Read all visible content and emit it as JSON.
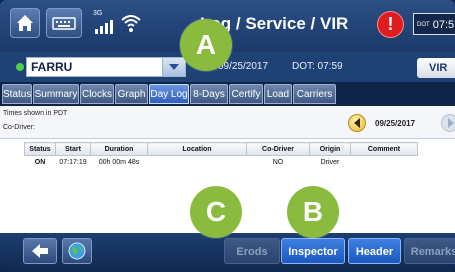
{
  "header": {
    "title": "Log / Service / VIR",
    "alert_symbol": "!",
    "dot_label": "DOT",
    "dot_time": "07:5",
    "network_label": "3G"
  },
  "driver": {
    "name": "FARRU",
    "date": "09/25/2017",
    "dot_time": "DOT: 07:59",
    "vir_label": "VIR"
  },
  "tabs": [
    {
      "label": "Status"
    },
    {
      "label": "Summary"
    },
    {
      "label": "Clocks"
    },
    {
      "label": "Graph"
    },
    {
      "label": "Day Log",
      "active": true
    },
    {
      "label": "8-Days"
    },
    {
      "label": "Certify"
    },
    {
      "label": "Load"
    },
    {
      "label": "Carriers"
    }
  ],
  "log": {
    "tz_note": "Times shown in PDT",
    "codriver_label": "Co-Driver:",
    "date": "09/25/2017",
    "columns": [
      "Status",
      "Start",
      "Duration",
      "Location",
      "Co-Driver",
      "Origin",
      "Comment"
    ],
    "rows": [
      {
        "status": "ON",
        "start": "07:17:19",
        "duration": "00h 00m 48s",
        "location": "",
        "codriver": "NO",
        "origin": "Driver",
        "comment": ""
      }
    ]
  },
  "footer": {
    "erods": "Erods",
    "inspector": "Inspector",
    "header": "Header",
    "remarks": "Remarks"
  },
  "callouts": {
    "a": "A",
    "b": "B",
    "c": "C"
  },
  "colors": {
    "accent": "#2e5fbf",
    "callout": "#8abb3f",
    "alert": "#e01c1c",
    "status_online": "#4ed04a"
  },
  "icons": [
    "home-icon",
    "keyboard-icon",
    "signal-icon",
    "wifi-icon",
    "alert-icon",
    "back-arrow-icon",
    "globe-icon",
    "chevron-down-icon",
    "chevron-left-icon",
    "chevron-right-icon"
  ]
}
